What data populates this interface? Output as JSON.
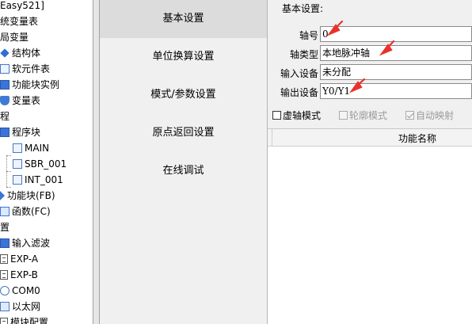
{
  "tree": {
    "items": [
      {
        "label": "Easy521]",
        "icon": "none",
        "indent": 0
      },
      {
        "label": "统变量表",
        "icon": "none",
        "indent": 0
      },
      {
        "label": "局变量",
        "icon": "none",
        "indent": 0
      },
      {
        "label": "结构体",
        "icon": "diamond-icon",
        "indent": 1
      },
      {
        "label": "软元件表",
        "icon": "document-icon",
        "indent": 1
      },
      {
        "label": "功能块实例",
        "icon": "block-icon",
        "indent": 1
      },
      {
        "label": "变量表",
        "icon": "shield-icon",
        "indent": 1
      },
      {
        "label": "程",
        "icon": "none",
        "indent": 0
      },
      {
        "label": "程序块",
        "icon": "block-icon",
        "indent": 1
      },
      {
        "label": "MAIN",
        "icon": "document-icon",
        "indent": 2
      },
      {
        "label": "SBR_001",
        "icon": "document-icon",
        "indent": 2
      },
      {
        "label": "INT_001",
        "icon": "document-icon",
        "indent": 2
      },
      {
        "label": "功能块(FB)",
        "icon": "block-icon",
        "indent": 1
      },
      {
        "label": "函数(FC)",
        "icon": "function-icon",
        "indent": 1
      },
      {
        "label": "置",
        "icon": "none",
        "indent": 0
      },
      {
        "label": "输入滤波",
        "icon": "filter-icon",
        "indent": 1
      },
      {
        "label": "EXP-A",
        "icon": "module-icon",
        "indent": 1
      },
      {
        "label": "EXP-B",
        "icon": "module-icon",
        "indent": 1
      },
      {
        "label": "COM0",
        "icon": "port-icon",
        "indent": 1
      },
      {
        "label": "以太网",
        "icon": "network-icon",
        "indent": 1
      },
      {
        "label": "模块配置",
        "icon": "module-icon",
        "indent": 1
      }
    ]
  },
  "nav": {
    "items": [
      {
        "label": "基本设置",
        "active": true
      },
      {
        "label": "单位换算设置",
        "active": false
      },
      {
        "label": "模式/参数设置",
        "active": false
      },
      {
        "label": "原点返回设置",
        "active": false
      },
      {
        "label": "在线调试",
        "active": false
      }
    ]
  },
  "panel": {
    "title": "基本设置:",
    "fields": {
      "axis_no": {
        "label": "轴号",
        "value": "0"
      },
      "axis_type": {
        "label": "轴类型",
        "value": "本地脉冲轴"
      },
      "input_device": {
        "label": "输入设备",
        "value": "未分配"
      },
      "output_device": {
        "label": "输出设备",
        "value": "Y0/Y1"
      }
    },
    "checkboxes": {
      "virtual_axis": {
        "label": "虚轴模式",
        "checked": false,
        "enabled": true
      },
      "contour_mode": {
        "label": "轮廓模式",
        "checked": false,
        "enabled": false
      },
      "auto_map": {
        "label": "自动映射",
        "checked": true,
        "enabled": false
      }
    },
    "table": {
      "column": "功能名称"
    }
  },
  "colors": {
    "annotation_arrow": "#e8322b",
    "nav_active": "#dcdcdc",
    "panel_bg": "#f0f0f0"
  }
}
